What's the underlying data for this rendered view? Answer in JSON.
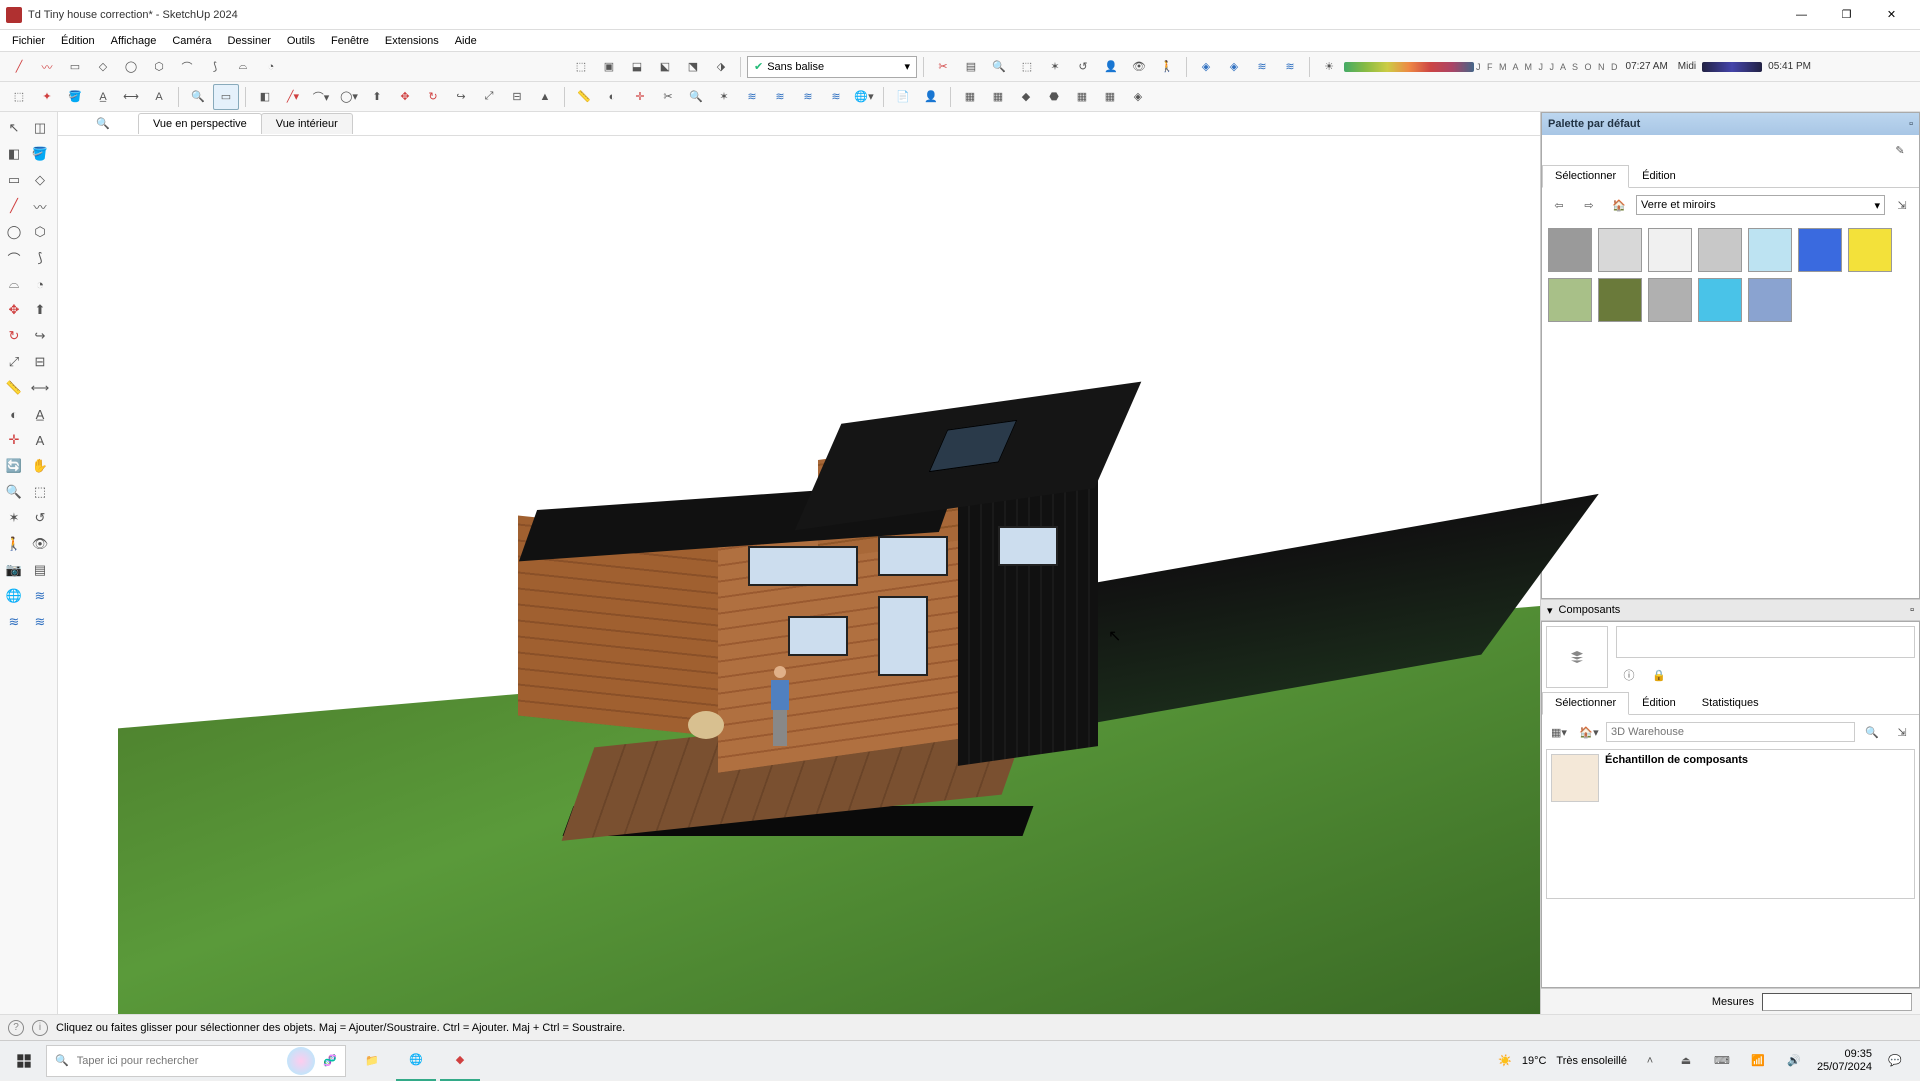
{
  "window": {
    "title": "Td Tiny house correction* - SketchUp 2024",
    "minimize": "—",
    "maximize": "❐",
    "close": "✕"
  },
  "menu": {
    "fichier": "Fichier",
    "edition": "Édition",
    "affichage": "Affichage",
    "camera": "Caméra",
    "dessiner": "Dessiner",
    "outils": "Outils",
    "fenetre": "Fenêtre",
    "extensions": "Extensions",
    "aide": "Aide"
  },
  "tag_selector": {
    "label": "Sans balise"
  },
  "shadows": {
    "months": "J F M A M J J A S O N D",
    "time_start": "07:27 AM",
    "noon": "Midi",
    "time_end": "05:41 PM"
  },
  "view_tabs": {
    "perspective": "Vue en perspective",
    "interior": "Vue intérieur"
  },
  "materials_panel": {
    "title": "Palette par défaut",
    "tab_select": "Sélectionner",
    "tab_edit": "Édition",
    "category": "Verre et miroirs",
    "swatch_colors": [
      "#9a9a9a",
      "#d8d8d8",
      "#f0f0f0",
      "#c8c8c8",
      "#bde3f2",
      "#3a6adf",
      "#f3e13a",
      "#a8c088",
      "#6a7a3a",
      "#b0b0b0",
      "#49c3e8",
      "#8aa3d0"
    ]
  },
  "components_panel": {
    "title": "Composants",
    "tab_select": "Sélectionner",
    "tab_edit": "Édition",
    "tab_stats": "Statistiques",
    "search_placeholder": "3D Warehouse",
    "sample_label": "Échantillon de composants"
  },
  "measures": {
    "label": "Mesures"
  },
  "status": {
    "hint": "Cliquez ou faites glisser pour sélectionner des objets. Maj = Ajouter/Soustraire. Ctrl = Ajouter. Maj + Ctrl = Soustraire."
  },
  "taskbar": {
    "search_placeholder": "Taper ici pour rechercher",
    "weather_temp": "19°C",
    "weather_desc": "Très ensoleillé",
    "time": "09:35",
    "date": "25/07/2024"
  }
}
